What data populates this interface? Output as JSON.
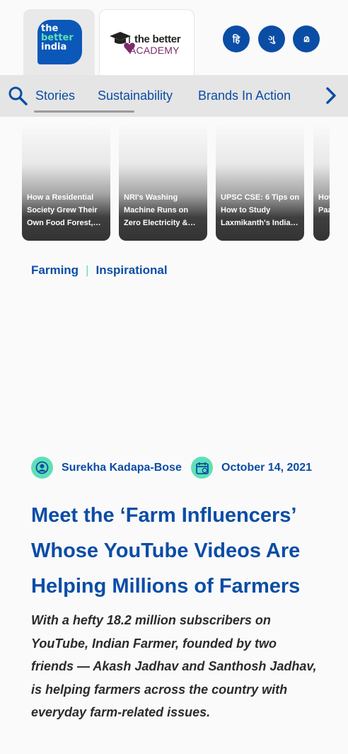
{
  "header": {
    "brand_logo": {
      "line1": "the",
      "line2": "better",
      "line3": "india"
    },
    "academy_logo": {
      "line1": "the better",
      "line2": "ACADEMY"
    },
    "languages": [
      {
        "label": "हि",
        "icon": "hindi-language-icon"
      },
      {
        "label": "ગુ",
        "icon": "gujarati-language-icon"
      },
      {
        "label": "മ",
        "icon": "malayalam-language-icon"
      }
    ]
  },
  "nav": {
    "items": [
      {
        "label": "Stories",
        "active": true
      },
      {
        "label": "Sustainability",
        "active": false
      },
      {
        "label": "Brands In Action",
        "active": false
      }
    ]
  },
  "stories": [
    {
      "text": "How a Residential Society Grew Their Own Food Forest,…"
    },
    {
      "text": "NRI's Washing Machine Runs on Zero Electricity &…"
    },
    {
      "text": "UPSC CSE: 6 Tips on How to Study Laxmikanth's India…"
    },
    {
      "text": "How Tur Paa…"
    }
  ],
  "article": {
    "categories": [
      "Farming",
      "Inspirational"
    ],
    "category_separator": "|",
    "author": "Surekha Kadapa-Bose",
    "date": "October 14, 2021",
    "title": "Meet the ‘Farm Influencers’ Whose YouTube Videos Are Helping Millions of Farmers",
    "excerpt": "With a hefty 18.2 million subscribers on YouTube, Indian Farmer, founded by two friends — Akash Jadhav and Santhosh Jadhav, is helping farmers across the country with everyday farm-related issues."
  },
  "colors": {
    "brand_blue": "#0b4da5",
    "accent_mint": "#5ee0b6",
    "academy_purple": "#7b2b6b"
  }
}
